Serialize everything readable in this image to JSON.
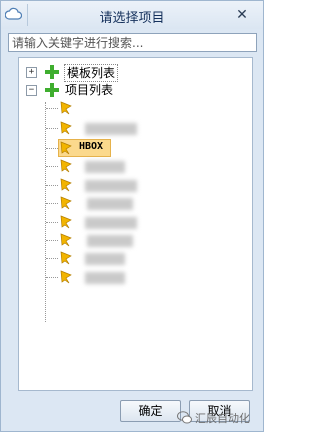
{
  "window": {
    "title": "请选择项目"
  },
  "search": {
    "placeholder": "请输入关键字进行搜索..."
  },
  "tree": {
    "nodes": [
      {
        "label": "模板列表",
        "expander": "+"
      },
      {
        "label": "项目列表",
        "expander": "−"
      }
    ],
    "selected_child": "HBOX"
  },
  "buttons": {
    "ok": "确定",
    "cancel": "取消"
  },
  "watermark": "汇辰自动化",
  "colors": {
    "selection": "#fbd98d",
    "plus": "#3fae2f",
    "flag": "#f2b400"
  }
}
